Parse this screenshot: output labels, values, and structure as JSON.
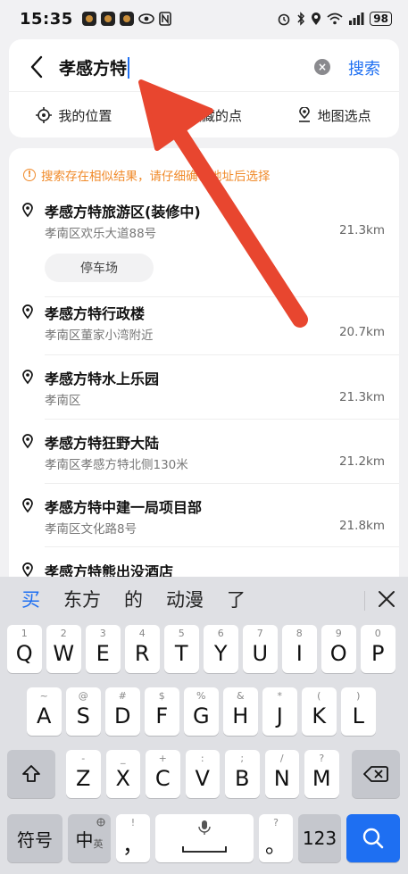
{
  "status_bar": {
    "time": "15:35",
    "battery": "98"
  },
  "search": {
    "query": "孝感方特",
    "search_button": "搜索"
  },
  "quick_actions": [
    {
      "label": "我的位置",
      "icon": "locate-icon"
    },
    {
      "label": "收藏的点",
      "icon": "star-icon"
    },
    {
      "label": "地图选点",
      "icon": "map-pin-icon"
    }
  ],
  "notice": "搜索存在相似结果，请仔细确认地址后选择",
  "results": [
    {
      "name": "孝感方特旅游区(装修中)",
      "address": "孝南区欢乐大道88号",
      "distance": "21.3km",
      "tag": "停车场"
    },
    {
      "name": "孝感方特行政楼",
      "address": "孝南区董家小湾附近",
      "distance": "20.7km"
    },
    {
      "name": "孝感方特水上乐园",
      "address": "孝南区",
      "distance": "21.3km"
    },
    {
      "name": "孝感方特狂野大陆",
      "address": "孝南区孝感方特北侧130米",
      "distance": "21.2km"
    },
    {
      "name": "孝感方特中建一局项目部",
      "address": "孝南区文化路8号",
      "distance": "21.8km"
    },
    {
      "name": "孝感方特熊出没酒店",
      "address": "",
      "distance": ""
    }
  ],
  "keyboard": {
    "candidates": [
      "买",
      "东方",
      "的",
      "动漫",
      "了"
    ],
    "row1": [
      {
        "k": "Q",
        "s": "1"
      },
      {
        "k": "W",
        "s": "2"
      },
      {
        "k": "E",
        "s": "3"
      },
      {
        "k": "R",
        "s": "4"
      },
      {
        "k": "T",
        "s": "5"
      },
      {
        "k": "Y",
        "s": "6"
      },
      {
        "k": "U",
        "s": "7"
      },
      {
        "k": "I",
        "s": "8"
      },
      {
        "k": "O",
        "s": "9"
      },
      {
        "k": "P",
        "s": "0"
      }
    ],
    "row2": [
      {
        "k": "A",
        "s": "~"
      },
      {
        "k": "S",
        "s": "@"
      },
      {
        "k": "D",
        "s": "#"
      },
      {
        "k": "F",
        "s": "$"
      },
      {
        "k": "G",
        "s": "%"
      },
      {
        "k": "H",
        "s": "&"
      },
      {
        "k": "J",
        "s": "*"
      },
      {
        "k": "K",
        "s": "("
      },
      {
        "k": "L",
        "s": ")"
      }
    ],
    "row3": [
      {
        "k": "Z",
        "s": "-"
      },
      {
        "k": "X",
        "s": "_"
      },
      {
        "k": "C",
        "s": "+"
      },
      {
        "k": "V",
        "s": ":"
      },
      {
        "k": "B",
        "s": ";"
      },
      {
        "k": "N",
        "s": "/"
      },
      {
        "k": "M",
        "s": "?"
      }
    ],
    "symbols_key": "符号",
    "lang_key": "中",
    "lang_sub": "英",
    "comma_key": "，",
    "comma_sub": "!",
    "period_key": "。",
    "period_sub": "?",
    "num_key": "123"
  },
  "colors": {
    "accent": "#1e6ff2",
    "warning": "#f08a2a",
    "annotation_arrow": "#e8462f"
  }
}
